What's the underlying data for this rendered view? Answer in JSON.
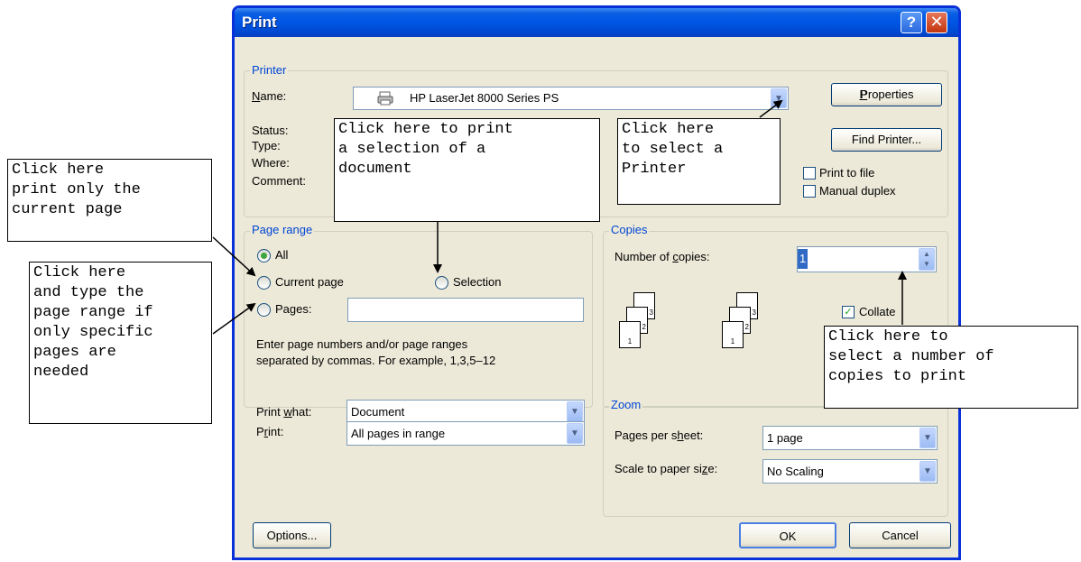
{
  "dialog": {
    "title": "Print",
    "help_glyph": "?",
    "close_glyph": "✕"
  },
  "printer": {
    "group_label": "Printer",
    "name_label": "Name:",
    "name_value": "HP LaserJet 8000 Series PS",
    "status_label": "Status:",
    "type_label": "Type:",
    "where_label": "Where:",
    "comment_label": "Comment:",
    "properties_button": "Properties",
    "find_printer_button": "Find Printer...",
    "print_to_file_label": "Print to file",
    "manual_duplex_label": "Manual duplex",
    "print_to_file_checked": false,
    "manual_duplex_checked": false
  },
  "page_range": {
    "group_label": "Page range",
    "all_label": "All",
    "current_page_label": "Current page",
    "selection_label": "Selection",
    "pages_label": "Pages:",
    "pages_value": "",
    "selected": "All",
    "help_line1": "Enter page numbers and/or page ranges",
    "help_line2": "separated by commas.  For example, 1,3,5–12"
  },
  "copies": {
    "group_label": "Copies",
    "number_label": "Number of copies:",
    "number_value": "1",
    "collate_label": "Collate",
    "collate_checked": true,
    "page_numbers": [
      "3",
      "2",
      "1"
    ]
  },
  "print_what": {
    "label": "Print what:",
    "value": "Document"
  },
  "print": {
    "label": "Print:",
    "value": "All pages in range"
  },
  "zoom": {
    "group_label": "Zoom",
    "pages_per_sheet_label": "Pages per sheet:",
    "pages_per_sheet_value": "1 page",
    "scale_label": "Scale to paper size:",
    "scale_value": "No Scaling"
  },
  "buttons": {
    "options": "Options...",
    "ok": "OK",
    "cancel": "Cancel"
  },
  "callouts": {
    "current_page": "Click here\nprint only the\ncurrent page",
    "pages_range": "Click here\nand type the\npage range if\nonly specific\npages are\nneeded",
    "selection": "Click here to print\na selection of a\ndocument",
    "printer": "Click here\nto select a\nPrinter",
    "copies": "Click here to\nselect a number of\ncopies to print"
  },
  "colors": {
    "title_bar": "#0055e5",
    "dialog_bg": "#ece9d8",
    "group_label": "#0046d5"
  }
}
